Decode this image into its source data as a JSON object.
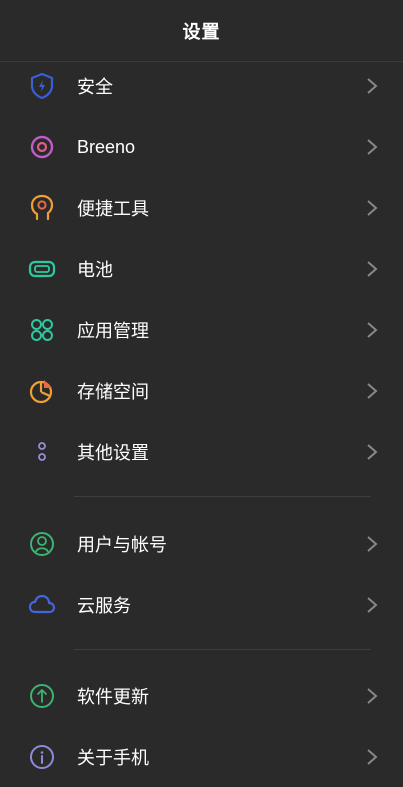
{
  "header": {
    "title": "设置"
  },
  "items": [
    {
      "label": "安全",
      "icon": "shield-icon",
      "color": "#3a5fd9"
    },
    {
      "label": "Breeno",
      "icon": "breeno-icon",
      "color": "#c05cc9"
    },
    {
      "label": "便捷工具",
      "icon": "head-gear-icon",
      "color": "#f0a030"
    },
    {
      "label": "电池",
      "icon": "battery-icon",
      "color": "#2cc9a0"
    },
    {
      "label": "应用管理",
      "icon": "apps-icon",
      "color": "#2cc9a0"
    },
    {
      "label": "存储空间",
      "icon": "pie-chart-icon",
      "color": "#f0a030"
    },
    {
      "label": "其他设置",
      "icon": "dots-icon",
      "color": "#9a8cd8"
    },
    {
      "label": "用户与帐号",
      "icon": "user-icon",
      "color": "#3cb371"
    },
    {
      "label": "云服务",
      "icon": "cloud-icon",
      "color": "#4466dd"
    },
    {
      "label": "软件更新",
      "icon": "upload-icon",
      "color": "#3cb371"
    },
    {
      "label": "关于手机",
      "icon": "info-icon",
      "color": "#8a8cd8"
    }
  ]
}
